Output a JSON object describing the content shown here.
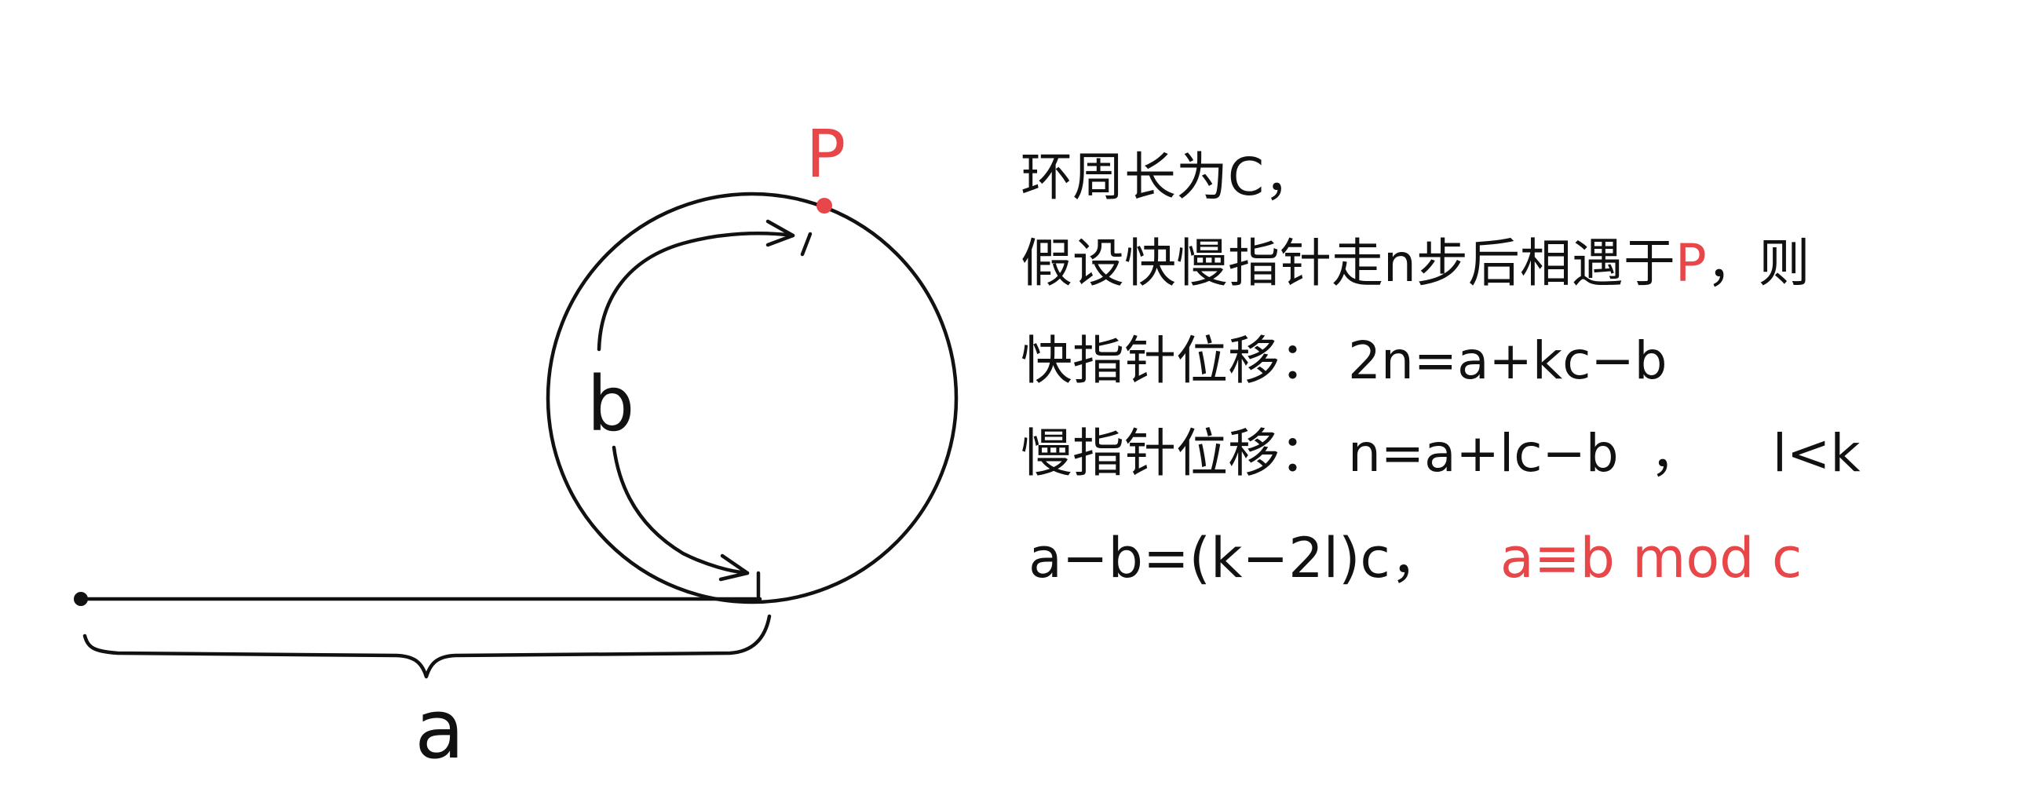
{
  "figure": {
    "label_p": "P",
    "label_b": "b",
    "label_a": "a",
    "colors": {
      "ink": "#111111",
      "accent": "#e8474a"
    }
  },
  "notes": {
    "line1": "环周长为C，",
    "line2_prefix": "假设快慢指针走n步后相遇于",
    "line2_p": "P",
    "line2_suffix": "，则",
    "line3": "快指针位移： 2n=a+kc−b",
    "line4_main": "慢指针位移： n=a+lc−b",
    "line4_sep": "，",
    "line4_cond": "l<k",
    "line5_main": "a−b=(k−2l)c，",
    "line5_mod": "a≡b mod c"
  }
}
